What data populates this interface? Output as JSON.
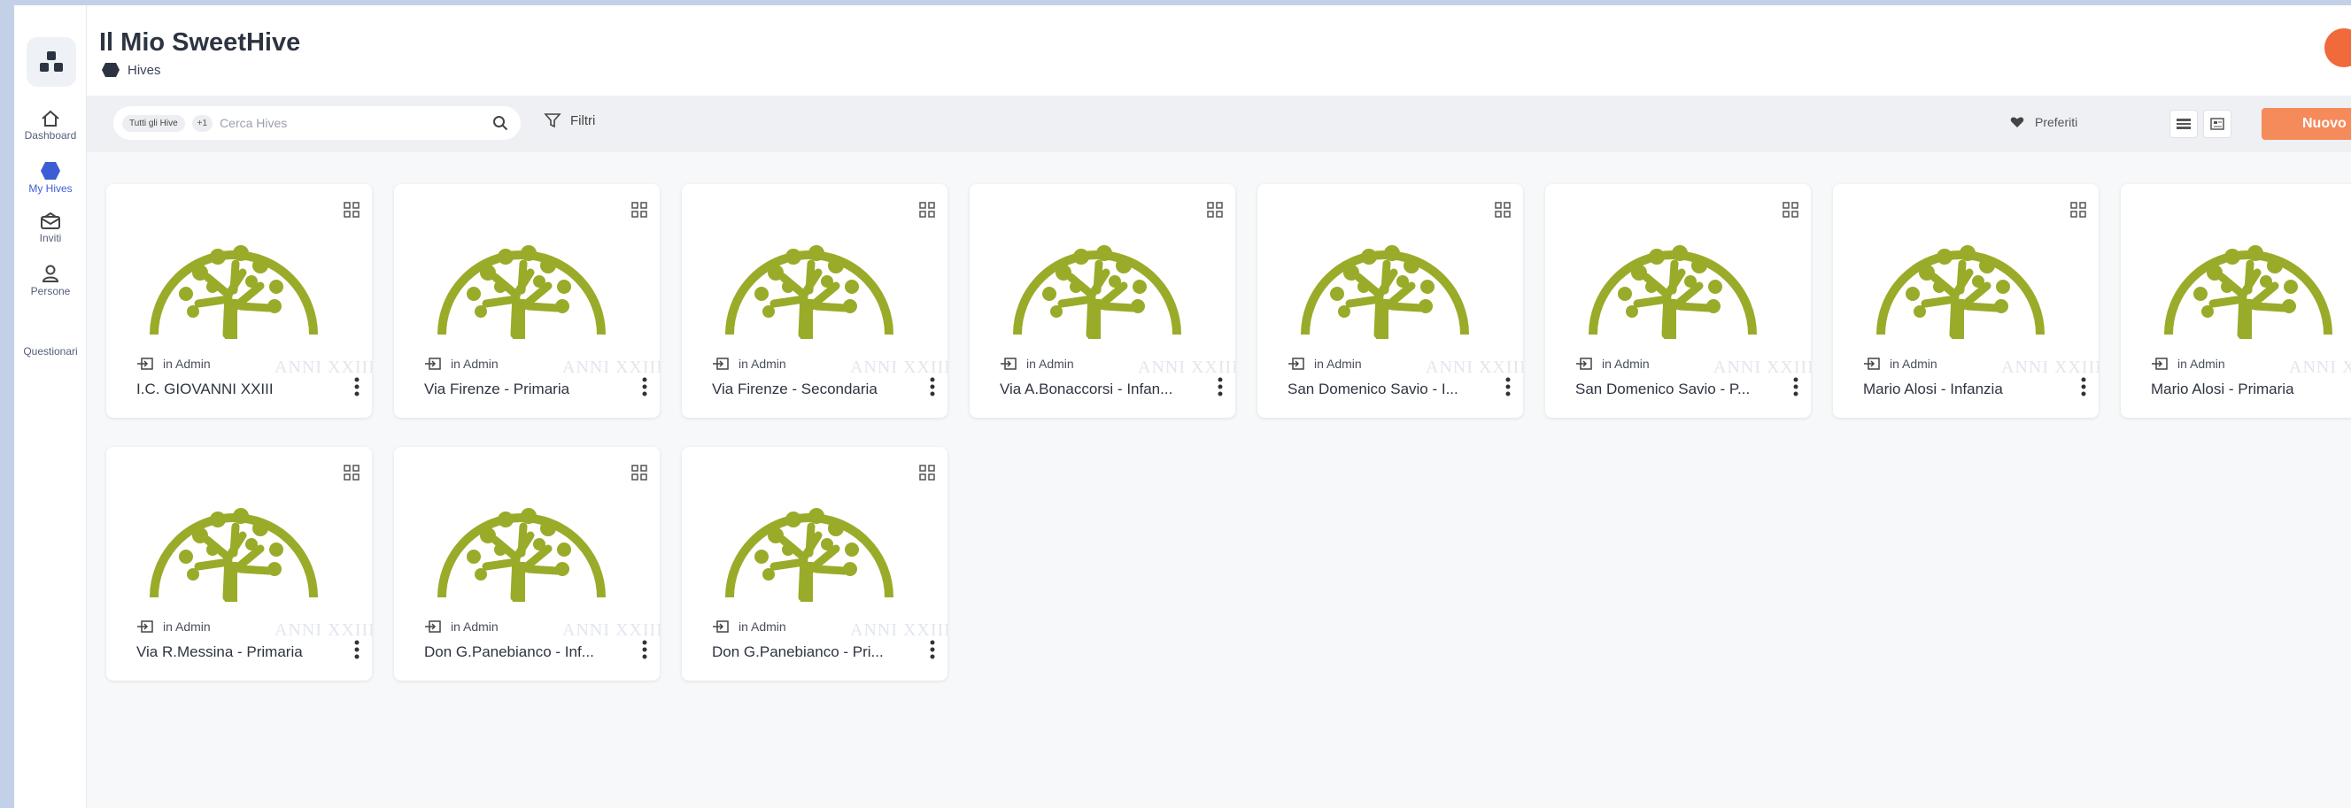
{
  "app": {
    "title": "Il Mio SweetHive",
    "breadcrumb": "Hives"
  },
  "sidebar": {
    "items": [
      {
        "label": "Dashboard",
        "icon": "home-icon"
      },
      {
        "label": "My Hives",
        "icon": "hive-icon"
      },
      {
        "label": "Inviti",
        "icon": "mail-icon"
      },
      {
        "label": "Persone",
        "icon": "person-icon"
      },
      {
        "label": "Questionari",
        "icon": "survey-icon"
      }
    ]
  },
  "toolbar": {
    "scope_chip": "Tutti gli Hive",
    "extra_chip": "+1",
    "search_placeholder": "Cerca Hives",
    "filters_label": "Filtri",
    "favorites_label": "Preferiti",
    "new_button": "Nuovo Hive"
  },
  "hives": [
    {
      "role": "in Admin",
      "name": "I.C. GIOVANNI XXIII",
      "watermark": "ANNI XXIII"
    },
    {
      "role": "in Admin",
      "name": "Via Firenze - Primaria",
      "watermark": "ANNI XXIII"
    },
    {
      "role": "in Admin",
      "name": "Via Firenze - Secondaria",
      "watermark": "ANNI XXIII"
    },
    {
      "role": "in Admin",
      "name": "Via A.Bonaccorsi - Infan...",
      "watermark": "ANNI XXIII"
    },
    {
      "role": "in Admin",
      "name": "San Domenico Savio - I...",
      "watermark": "ANNI XXIII"
    },
    {
      "role": "in Admin",
      "name": "San Domenico Savio - P...",
      "watermark": "ANNI XXIII"
    },
    {
      "role": "in Admin",
      "name": "Mario Alosi - Infanzia",
      "watermark": "ANNI XXIII"
    },
    {
      "role": "in Admin",
      "name": "Mario Alosi - Primaria",
      "watermark": "ANNI XXIII"
    },
    {
      "role": "in Admin",
      "name": "Via R.Messina - Primaria",
      "watermark": "ANNI XXIII"
    },
    {
      "role": "in Admin",
      "name": "Don G.Panebianco - Inf...",
      "watermark": "ANNI XXIII"
    },
    {
      "role": "in Admin",
      "name": "Don G.Panebianco - Pri...",
      "watermark": "ANNI XXIII"
    }
  ],
  "colors": {
    "accent": "#f58a5b",
    "tree": "#9aab2a",
    "active_nav": "#3c5dd6"
  }
}
